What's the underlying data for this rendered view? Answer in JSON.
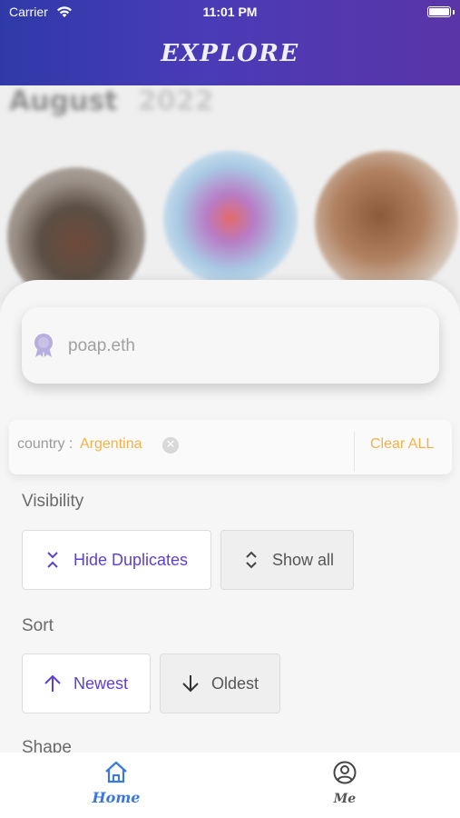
{
  "status_bar": {
    "carrier": "Carrier",
    "time": "11:01 PM"
  },
  "header": {
    "title": "EXPLORE"
  },
  "background": {
    "month": "August",
    "year": "2022"
  },
  "search": {
    "placeholder": "poap.eth",
    "icon": "badge-icon"
  },
  "filter": {
    "key": "country : ",
    "value": "Argentina",
    "clear_label": "Clear ALL"
  },
  "visibility": {
    "label": "Visibility",
    "options": [
      {
        "label": "Hide Duplicates",
        "icon": "collapse-icon",
        "active": true
      },
      {
        "label": "Show all",
        "icon": "expand-icon",
        "active": false
      }
    ]
  },
  "sort": {
    "label": "Sort",
    "options": [
      {
        "label": "Newest",
        "icon": "arrow-up-icon",
        "active": true
      },
      {
        "label": "Oldest",
        "icon": "arrow-down-icon",
        "active": false
      }
    ]
  },
  "shape": {
    "label": "Shape"
  },
  "tabbar": {
    "items": [
      {
        "label": "Home",
        "icon": "home-icon",
        "active": true
      },
      {
        "label": "Me",
        "icon": "user-circle-icon",
        "active": false
      }
    ]
  },
  "colors": {
    "accent": "#5f3fd3",
    "filter_value": "#f3b24a",
    "tab_active": "#3a78e0"
  }
}
